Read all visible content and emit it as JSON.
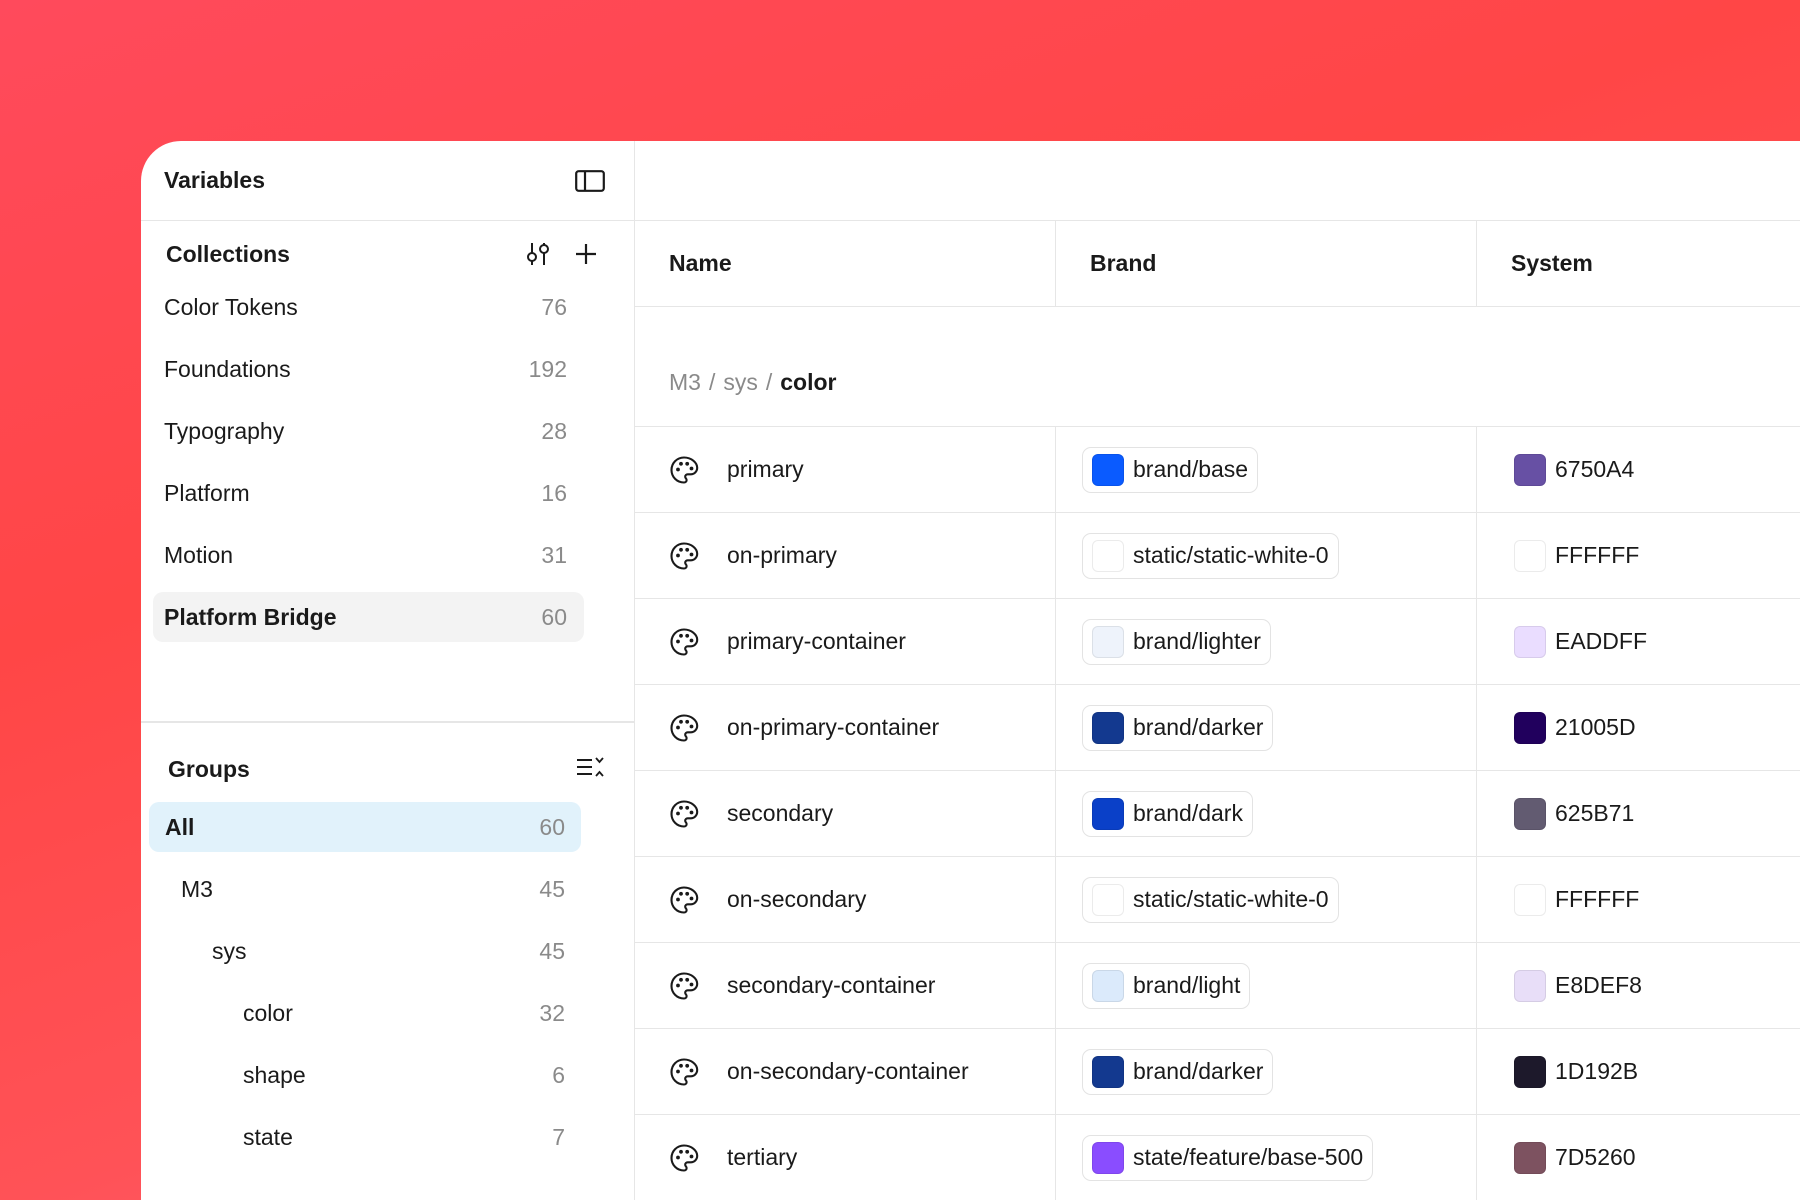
{
  "panel": {
    "title": "Variables",
    "toggle_icon": "sidebar-toggle-icon"
  },
  "collections": {
    "title": "Collections",
    "filter_icon": "sliders-icon",
    "add_icon": "plus-icon",
    "items": [
      {
        "label": "Color Tokens",
        "count": "76"
      },
      {
        "label": "Foundations",
        "count": "192"
      },
      {
        "label": "Typography",
        "count": "28"
      },
      {
        "label": "Platform",
        "count": "16"
      },
      {
        "label": "Motion",
        "count": "31"
      },
      {
        "label": "Platform Bridge",
        "count": "60",
        "active": true
      }
    ]
  },
  "groups": {
    "title": "Groups",
    "collapse_icon": "collapse-list-icon",
    "items": [
      {
        "label": "All",
        "count": "60",
        "selected": true,
        "indent": 0
      },
      {
        "label": "M3",
        "count": "45",
        "indent": 1
      },
      {
        "label": "sys",
        "count": "45",
        "indent": 2
      },
      {
        "label": "color",
        "count": "32",
        "indent": 3
      },
      {
        "label": "shape",
        "count": "6",
        "indent": 3
      },
      {
        "label": "state",
        "count": "7",
        "indent": 3
      }
    ]
  },
  "table": {
    "columns": {
      "name": "Name",
      "brand": "Brand",
      "system": "System"
    },
    "breadcrumb": {
      "part1": "M3",
      "part2": "sys",
      "current": "color",
      "separator": "/"
    },
    "rows": [
      {
        "name": "primary",
        "brand": "brand/base",
        "brand_color": "#0A5BFF",
        "system": "6750A4",
        "system_color": "#6750A4"
      },
      {
        "name": "on-primary",
        "brand": "static/static-white-0",
        "brand_color": "#FFFFFF",
        "system": "FFFFFF",
        "system_color": "#FFFFFF"
      },
      {
        "name": "primary-container",
        "brand": "brand/lighter",
        "brand_color": "#EEF3FB",
        "system": "EADDFF",
        "system_color": "#EADDFF"
      },
      {
        "name": "on-primary-container",
        "brand": "brand/darker",
        "brand_color": "#13398F",
        "system": "21005D",
        "system_color": "#21005D"
      },
      {
        "name": "secondary",
        "brand": "brand/dark",
        "brand_color": "#0A40C8",
        "system": "625B71",
        "system_color": "#625B71"
      },
      {
        "name": "on-secondary",
        "brand": "static/static-white-0",
        "brand_color": "#FFFFFF",
        "system": "FFFFFF",
        "system_color": "#FFFFFF"
      },
      {
        "name": "secondary-container",
        "brand": "brand/light",
        "brand_color": "#DBEAFB",
        "system": "E8DEF8",
        "system_color": "#E8DEF8"
      },
      {
        "name": "on-secondary-container",
        "brand": "brand/darker",
        "brand_color": "#13398F",
        "system": "1D192B",
        "system_color": "#1D192B"
      },
      {
        "name": "tertiary",
        "brand": "state/feature/base-500",
        "brand_color": "#8A4DFF",
        "system": "7D5260",
        "system_color": "#7D5260"
      }
    ]
  }
}
